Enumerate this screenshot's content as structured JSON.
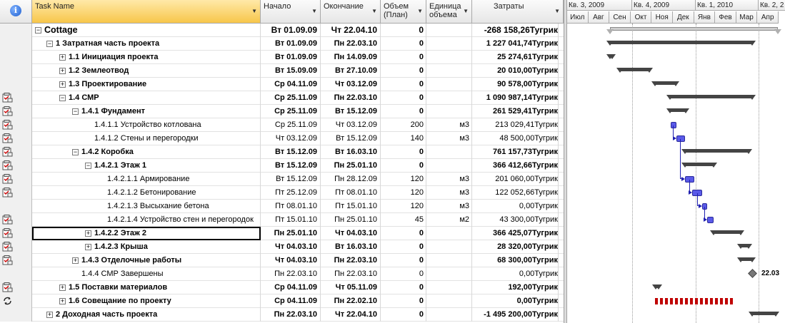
{
  "columns": {
    "indicators_icon": "info-icon",
    "task_name": "Task Name",
    "start": "Начало",
    "finish": "Окончание",
    "volume": "Объем (План)",
    "unit": "Единица объема",
    "cost": "Затраты"
  },
  "timescale": {
    "quarters": [
      "Кв. 3, 2009",
      "Кв. 4, 2009",
      "Кв. 1, 2010",
      "Кв. 2, 2"
    ],
    "months": [
      "Июл",
      "Авг",
      "Сен",
      "Окт",
      "Ноя",
      "Дек",
      "Янв",
      "Фев",
      "Мар",
      "Апр"
    ]
  },
  "tasks": [
    {
      "name": "Cottage",
      "level": 0,
      "bold": true,
      "toggle": "−",
      "start": "Вт 01.09.09",
      "finish": "Чт 22.04.10",
      "volume": "0",
      "unit": "",
      "cost": "-268 158,26Тугрик",
      "icon": ""
    },
    {
      "name": "1 Затратная часть проекта",
      "level": 1,
      "bold": true,
      "toggle": "−",
      "start": "Вт 01.09.09",
      "finish": "Пн 22.03.10",
      "volume": "0",
      "unit": "",
      "cost": "1 227 041,74Тугрик",
      "icon": ""
    },
    {
      "name": "1.1 Инициация проекта",
      "level": 2,
      "bold": true,
      "toggle": "+",
      "start": "Вт 01.09.09",
      "finish": "Пн 14.09.09",
      "volume": "0",
      "unit": "",
      "cost": "25 274,61Тугрик",
      "icon": ""
    },
    {
      "name": "1.2 Землеотвод",
      "level": 2,
      "bold": true,
      "toggle": "+",
      "start": "Вт 15.09.09",
      "finish": "Вт 27.10.09",
      "volume": "0",
      "unit": "",
      "cost": "20 010,00Тугрик",
      "icon": ""
    },
    {
      "name": "1.3 Проектирование",
      "level": 2,
      "bold": true,
      "toggle": "+",
      "start": "Ср 04.11.09",
      "finish": "Чт 03.12.09",
      "volume": "0",
      "unit": "",
      "cost": "90 578,00Тугрик",
      "icon": ""
    },
    {
      "name": "1.4 СМР",
      "level": 2,
      "bold": true,
      "toggle": "−",
      "start": "Ср 25.11.09",
      "finish": "Пн 22.03.10",
      "volume": "0",
      "unit": "",
      "cost": "1 090 987,14Тугрик",
      "icon": "notes-icon"
    },
    {
      "name": "1.4.1 Фундамент",
      "level": 3,
      "bold": true,
      "toggle": "−",
      "start": "Ср 25.11.09",
      "finish": "Вт 15.12.09",
      "volume": "0",
      "unit": "",
      "cost": "261 529,41Тугрик",
      "icon": "notes-icon"
    },
    {
      "name": "1.4.1.1 Устройство котлована",
      "level": 4,
      "bold": false,
      "toggle": "",
      "start": "Ср 25.11.09",
      "finish": "Чт 03.12.09",
      "volume": "200",
      "unit": "м3",
      "cost": "213 029,41Тугрик",
      "icon": "notes-icon"
    },
    {
      "name": "1.4.1.2 Стены и перегородки",
      "level": 4,
      "bold": false,
      "toggle": "",
      "start": "Чт 03.12.09",
      "finish": "Вт 15.12.09",
      "volume": "140",
      "unit": "м3",
      "cost": "48 500,00Тугрик",
      "icon": "notes-icon"
    },
    {
      "name": "1.4.2 Коробка",
      "level": 3,
      "bold": true,
      "toggle": "−",
      "start": "Вт 15.12.09",
      "finish": "Вт 16.03.10",
      "volume": "0",
      "unit": "",
      "cost": "761 157,73Тугрик",
      "icon": "notes-icon"
    },
    {
      "name": "1.4.2.1 Этаж 1",
      "level": 4,
      "bold": true,
      "toggle": "−",
      "start": "Вт 15.12.09",
      "finish": "Пн 25.01.10",
      "volume": "0",
      "unit": "",
      "cost": "366 412,66Тугрик",
      "icon": "notes-icon"
    },
    {
      "name": "1.4.2.1.1 Армирование",
      "level": 5,
      "bold": false,
      "toggle": "",
      "start": "Вт 15.12.09",
      "finish": "Пн 28.12.09",
      "volume": "120",
      "unit": "м3",
      "cost": "201 060,00Тугрик",
      "icon": "notes-icon"
    },
    {
      "name": "1.4.2.1.2 Бетонирование",
      "level": 5,
      "bold": false,
      "toggle": "",
      "start": "Пт 25.12.09",
      "finish": "Пт 08.01.10",
      "volume": "120",
      "unit": "м3",
      "cost": "122 052,66Тугрик",
      "icon": "notes-icon"
    },
    {
      "name": "1.4.2.1.3 Высыхание бетона",
      "level": 5,
      "bold": false,
      "toggle": "",
      "start": "Пт 08.01.10",
      "finish": "Пт 15.01.10",
      "volume": "120",
      "unit": "м3",
      "cost": "0,00Тугрик",
      "icon": ""
    },
    {
      "name": "1.4.2.1.4 Устройство стен и перегородок",
      "level": 5,
      "bold": false,
      "toggle": "",
      "start": "Пт 15.01.10",
      "finish": "Пн 25.01.10",
      "volume": "45",
      "unit": "м2",
      "cost": "43 300,00Тугрик",
      "icon": "notes-icon"
    },
    {
      "name": "1.4.2.2 Этаж 2",
      "level": 4,
      "bold": true,
      "toggle": "+",
      "start": "Пн 25.01.10",
      "finish": "Чт 04.03.10",
      "volume": "0",
      "unit": "",
      "cost": "366 425,07Тугрик",
      "icon": "notes-icon"
    },
    {
      "name": "1.4.2.3 Крыша",
      "level": 4,
      "bold": true,
      "toggle": "+",
      "start": "Чт 04.03.10",
      "finish": "Вт 16.03.10",
      "volume": "0",
      "unit": "",
      "cost": "28 320,00Тугрик",
      "icon": "notes-icon"
    },
    {
      "name": "1.4.3 Отделочные работы",
      "level": 3,
      "bold": true,
      "toggle": "+",
      "start": "Чт 04.03.10",
      "finish": "Пн 22.03.10",
      "volume": "0",
      "unit": "",
      "cost": "68 300,00Тугрик",
      "icon": "notes-icon"
    },
    {
      "name": "1.4.4 СМР Завершены",
      "level": 3,
      "bold": false,
      "toggle": "",
      "start": "Пн 22.03.10",
      "finish": "Пн 22.03.10",
      "volume": "0",
      "unit": "",
      "cost": "0,00Тугрик",
      "icon": ""
    },
    {
      "name": "1.5 Поставки материалов",
      "level": 2,
      "bold": true,
      "toggle": "+",
      "start": "Ср 04.11.09",
      "finish": "Чт 05.11.09",
      "volume": "0",
      "unit": "",
      "cost": "192,00Тугрик",
      "icon": "notes-icon"
    },
    {
      "name": "1.6 Совещание по проекту",
      "level": 2,
      "bold": true,
      "toggle": "+",
      "start": "Ср 04.11.09",
      "finish": "Пн 22.02.10",
      "volume": "0",
      "unit": "",
      "cost": "0,00Тугрик",
      "icon": "recurring-icon"
    },
    {
      "name": "2 Доходная часть проекта",
      "level": 1,
      "bold": true,
      "toggle": "+",
      "start": "Пн 22.03.10",
      "finish": "Чт 22.04.10",
      "volume": "0",
      "unit": "",
      "cost": "-1 495 200,00Тугрик",
      "icon": ""
    }
  ],
  "milestone_label": "22.03"
}
